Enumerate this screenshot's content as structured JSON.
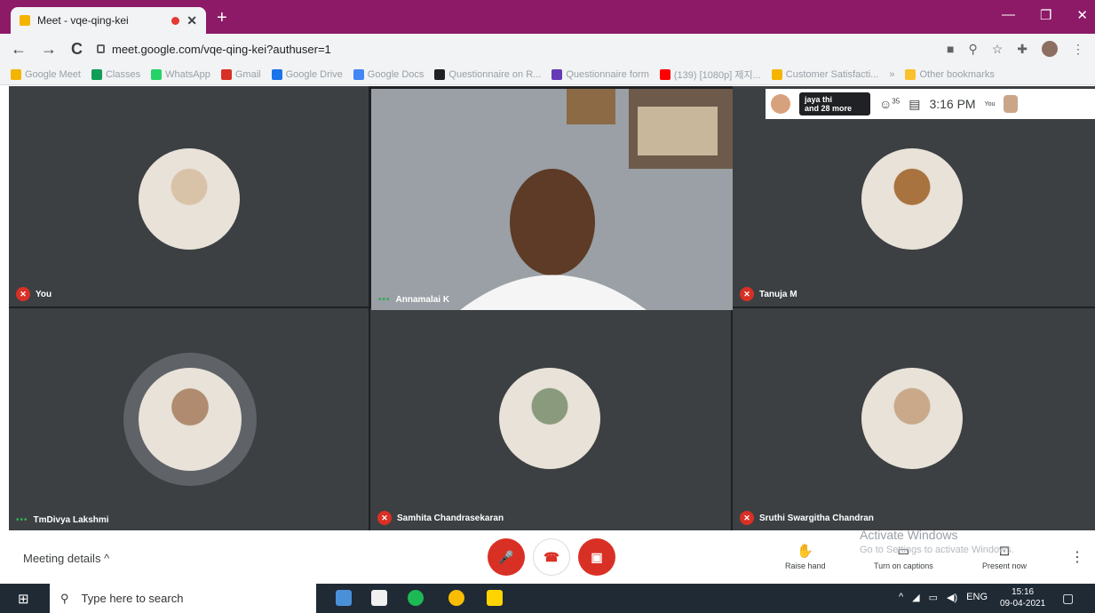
{
  "browser": {
    "tab_title": "Meet - vqe-qing-kei",
    "url": "meet.google.com/vqe-qing-kei?authuser=1",
    "bookmarks": [
      {
        "label": "Google Meet",
        "icon": "meet-icon",
        "color": "#f4b400"
      },
      {
        "label": "Classes",
        "icon": "classroom-icon",
        "color": "#0f9d58"
      },
      {
        "label": "WhatsApp",
        "icon": "whatsapp-icon",
        "color": "#25d366"
      },
      {
        "label": "Gmail",
        "icon": "gmail-icon",
        "color": "#d93025"
      },
      {
        "label": "Google Drive",
        "icon": "drive-icon",
        "color": "#1a73e8"
      },
      {
        "label": "Google Docs",
        "icon": "docs-icon",
        "color": "#4285f4"
      },
      {
        "label": "Questionnaire on R...",
        "icon": "b-icon",
        "color": "#202124"
      },
      {
        "label": "Questionnaire form",
        "icon": "forms-icon",
        "color": "#673ab7"
      },
      {
        "label": "(139) [1080p] 제지...",
        "icon": "youtube-icon",
        "color": "#ff0000"
      },
      {
        "label": "Customer Satisfacti...",
        "icon": "p-icon",
        "color": "#f4b400"
      }
    ],
    "bookmarks_more": "»",
    "other_bookmarks": "Other bookmarks"
  },
  "meet": {
    "topbar": {
      "participants_line1": "jaya thi",
      "participants_line2": "and 28 more",
      "people_count": "35",
      "time": "3:16 PM",
      "you_label": "You"
    },
    "tiles": [
      {
        "name": "You",
        "muted": true
      },
      {
        "name": "Annamalai K",
        "muted": false,
        "speaking": true
      },
      {
        "name": "Tanuja M",
        "muted": true
      },
      {
        "name": "TmDivya Lakshmi",
        "muted": false,
        "speaking": true
      },
      {
        "name": "Samhita Chandrasekaran",
        "muted": true
      },
      {
        "name": "Sruthi Swargitha Chandran",
        "muted": true
      }
    ],
    "controls": {
      "meeting_details": "Meeting details",
      "raise_hand": "Raise hand",
      "turn_on_captions": "Turn on captions",
      "present_now": "Present now"
    },
    "watermark": {
      "line1": "Activate Windows",
      "line2": "Go to Settings to activate Windows."
    }
  },
  "taskbar": {
    "search_placeholder": "Type here to search",
    "lang": "ENG",
    "time": "15:16",
    "date": "09-04-2021"
  },
  "colors": {
    "title_bar": "#8c1a67",
    "mute_red": "#d93025",
    "stage_bg": "#202124"
  }
}
